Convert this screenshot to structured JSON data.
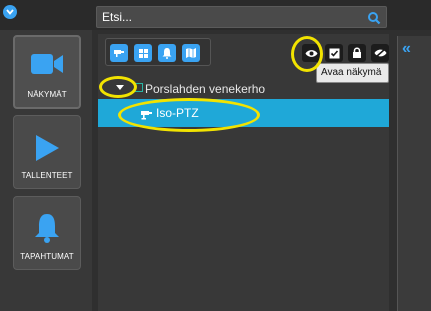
{
  "search": {
    "value": "Etsi..."
  },
  "nav": [
    {
      "label": "NÄKYMÄT",
      "icon": "video-camera-icon",
      "active": true
    },
    {
      "label": "TALLENTEET",
      "icon": "play-icon",
      "active": false
    },
    {
      "label": "TAPAHTUMAT",
      "icon": "bell-icon",
      "active": false
    }
  ],
  "toolbar": {
    "tools": [
      "camera-icon",
      "grid-icon",
      "bell-icon",
      "map-icon"
    ],
    "actions": [
      "eye-icon",
      "check-icon",
      "lock-icon",
      "eye-slash-icon"
    ],
    "tooltip": "Avaa näkymä"
  },
  "tree": {
    "group_label": "Porslahden venekerho",
    "camera_label": "Iso-PTZ"
  },
  "colors": {
    "accent": "#3aa3f2",
    "selected_row": "#1fa8d8",
    "highlight": "#f2e300"
  }
}
